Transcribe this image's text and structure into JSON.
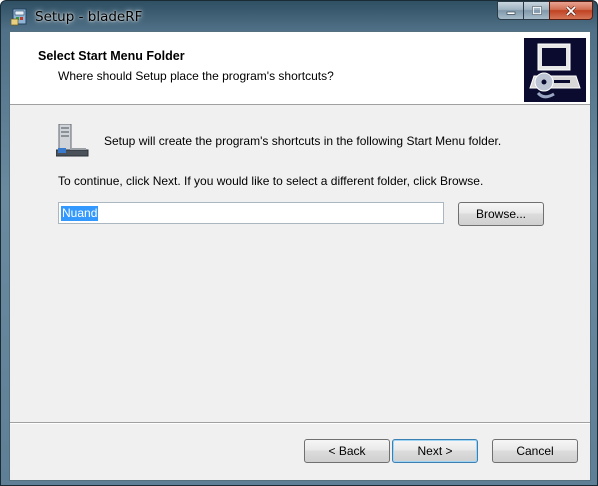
{
  "window": {
    "title": "Setup - bladeRF"
  },
  "header": {
    "title": "Select Start Menu Folder",
    "subtitle": "Where should Setup place the program's shortcuts?"
  },
  "body": {
    "info_text": "Setup will create the program's shortcuts in the following Start Menu folder.",
    "continue_text": "To continue, click Next. If you would like to select a different folder, click Browse.",
    "folder_value": "Nuand"
  },
  "buttons": {
    "browse_label": "Browse...",
    "back_label": "< Back",
    "next_label": "Next >",
    "cancel_label": "Cancel"
  },
  "icons": {
    "title_icon": "setup-icon",
    "header_image": "computer-cd-icon",
    "folder_icon": "start-menu-folder-icon"
  },
  "colors": {
    "selection": "#3399ff",
    "close_button": "#c7472a",
    "header_background": "#ffffff",
    "client_background": "#f0f0f0"
  }
}
